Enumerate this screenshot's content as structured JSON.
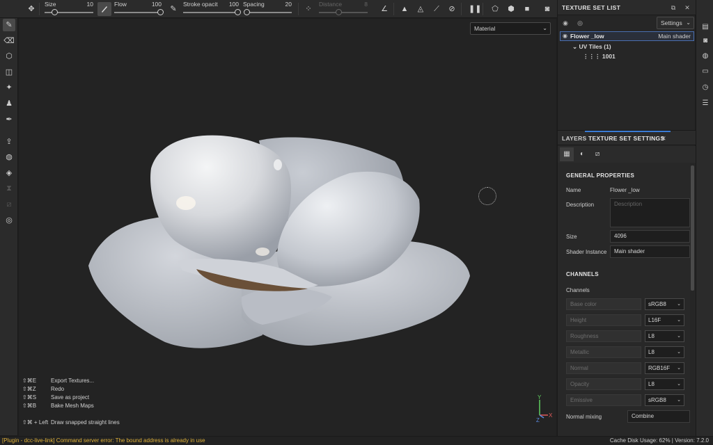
{
  "toolbar": {
    "size": {
      "label": "Size",
      "value": "10",
      "fraction": 0.2
    },
    "flow": {
      "label": "Flow",
      "value": "100",
      "fraction": 1.0
    },
    "stroke_opacity": {
      "label": "Stroke opacit",
      "value": "100",
      "fraction": 1.0
    },
    "spacing": {
      "label": "Spacing",
      "value": "20",
      "fraction": 0.05
    },
    "distance": {
      "label": "Distance",
      "value": "8",
      "fraction": 0.4
    }
  },
  "viewport": {
    "material_select": "Material",
    "shortcuts": [
      {
        "keys": "⇧⌘E",
        "action": "Export Textures..."
      },
      {
        "keys": "⇧⌘Z",
        "action": "Redo"
      },
      {
        "keys": "⇧⌘S",
        "action": "Save as project"
      },
      {
        "keys": "⇧⌘B",
        "action": "Bake Mesh Maps"
      },
      {
        "keys": "⇧⌘ + Left",
        "action": "Draw snapped straight lines"
      }
    ],
    "axis": {
      "y": "Y",
      "z": "Z",
      "x": "X"
    }
  },
  "texture_set_list": {
    "title": "TEXTURE SET LIST",
    "settings_label": "Settings",
    "texture_set": {
      "name": "Flower _low",
      "shader": "Main shader"
    },
    "uv_tiles": "UV Tiles (1)",
    "tile": "1001"
  },
  "tabs": {
    "layers": "LAYERS",
    "texture_set_settings": "TEXTURE SET SETTINGS"
  },
  "general": {
    "title": "GENERAL PROPERTIES",
    "name_label": "Name",
    "name_value": "Flower _low",
    "description_label": "Description",
    "description_placeholder": "Description",
    "size_label": "Size",
    "size_value": "4096",
    "shader_label": "Shader Instance",
    "shader_value": "Main shader"
  },
  "channels": {
    "title": "CHANNELS",
    "label": "Channels",
    "items": [
      {
        "name": "Base color",
        "format": "sRGB8"
      },
      {
        "name": "Height",
        "format": "L16F"
      },
      {
        "name": "Roughness",
        "format": "L8"
      },
      {
        "name": "Metallic",
        "format": "L8"
      },
      {
        "name": "Normal",
        "format": "RGB16F"
      },
      {
        "name": "Opacity",
        "format": "L8"
      },
      {
        "name": "Emissive",
        "format": "sRGB8"
      }
    ],
    "normal_mixing_label": "Normal mixing",
    "normal_mixing_value": "Combine"
  },
  "status": {
    "error": "[Plugin - dcc-live-link] Command server error: The bound address is already in use",
    "right": "Cache Disk Usage:    62% | Version: 7.2.0"
  },
  "colors": {
    "accent": "#3a7bd5",
    "error": "#e0b23a",
    "mesh": "#c9ccd2"
  }
}
